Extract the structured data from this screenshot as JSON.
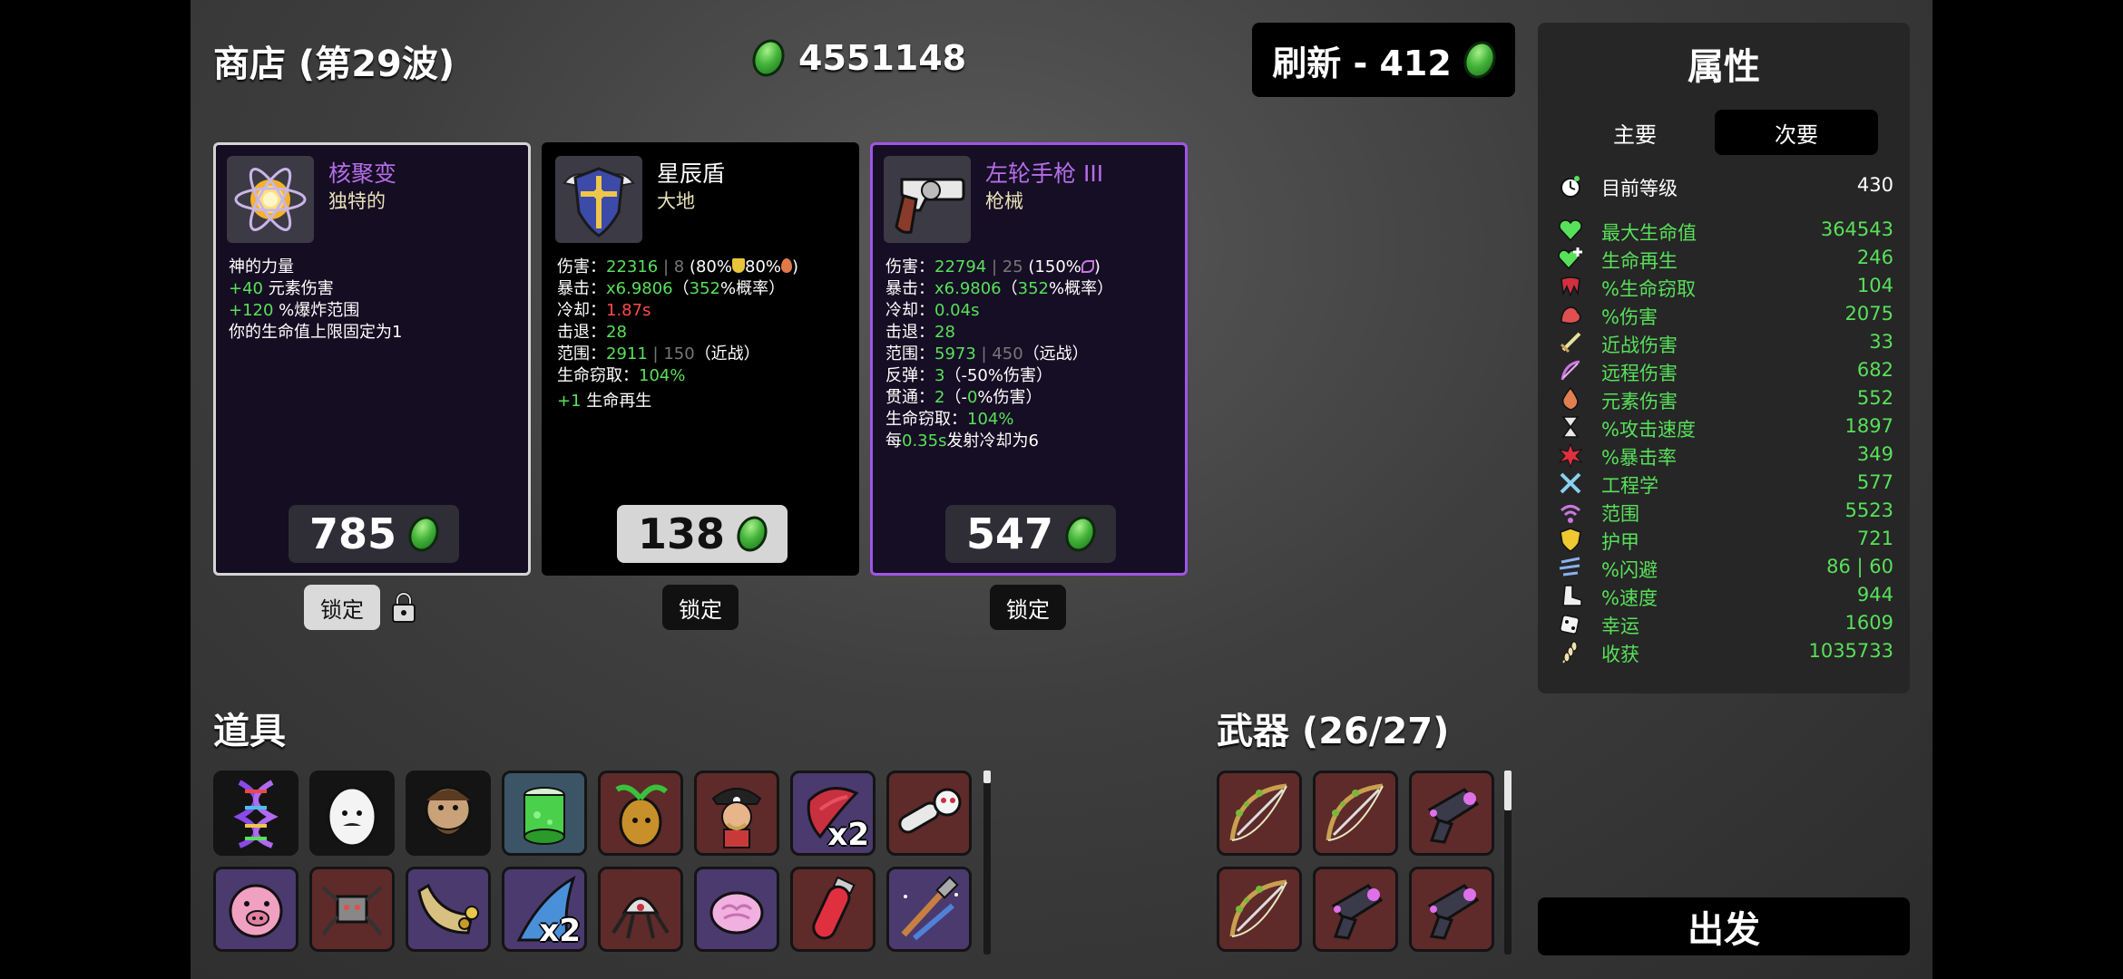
{
  "header": {
    "shop_title": "商店 (第29波)",
    "materials": "4551148",
    "reroll_label": "刷新 - 412"
  },
  "shop": {
    "items": [
      {
        "name": "核聚变",
        "name_color": "#b46ee8",
        "type": "独特的",
        "icon": "nuclear-atom-icon",
        "desc": {
          "l1": "神的力量",
          "l2_val": "+40",
          "l2_txt": " 元素伤害",
          "l3_val": "+120",
          "l3_txt": " %爆炸范围",
          "l4": "你的生命值上限固定为1"
        },
        "price": "785",
        "lock_label": "锁定",
        "locked": true
      },
      {
        "name": "星辰盾",
        "name_color": "#ffffff",
        "type": "大地",
        "icon": "star-shield-icon",
        "stats": {
          "dmg_k": "伤害：",
          "dmg_v": "22316",
          "dmg_sep": " | ",
          "dmg_base": "8",
          "dmg_tail": " (80%",
          "dmg_tail2": "80%",
          "dmg_close": ")",
          "crit_k": "暴击：",
          "crit_v": "x6.9806",
          "crit_tail": "（",
          "crit_pct": "352",
          "crit_tail2": "%概率）",
          "cd_k": "冷却：",
          "cd_v": "1.87s",
          "kb_k": "击退：",
          "kb_v": "28",
          "range_k": "范围：",
          "range_v": "2911",
          "range_sep": " | ",
          "range_base": "150",
          "range_tail": "（近战）",
          "ls_k": "生命窃取：",
          "ls_v": "104%",
          "extra_v": "+1",
          "extra_txt": " 生命再生"
        },
        "price": "138",
        "lock_label": "锁定"
      },
      {
        "name": "左轮手枪 III",
        "name_color": "#b46ee8",
        "type": "枪械",
        "icon": "revolver-icon",
        "stats": {
          "dmg_k": "伤害：",
          "dmg_v": "22794",
          "dmg_sep": " | ",
          "dmg_base": "25",
          "dmg_tail": " (150%",
          "dmg_close": ")",
          "crit_k": "暴击：",
          "crit_v": "x6.9806",
          "crit_tail": "（",
          "crit_pct": "352",
          "crit_tail2": "%概率）",
          "cd_k": "冷却：",
          "cd_v": "0.04s",
          "kb_k": "击退：",
          "kb_v": "28",
          "range_k": "范围：",
          "range_v": "5973",
          "range_sep": " | ",
          "range_base": "450",
          "range_tail": "（远战）",
          "bounce_k": "反弹：",
          "bounce_v": "3",
          "bounce_tail": "（-50%伤害）",
          "pierce_k": "贯通：",
          "pierce_v": "2",
          "pierce_tail1": "（-",
          "pierce_tail_v": "0",
          "pierce_tail2": "%伤害）",
          "ls_k": "生命窃取：",
          "ls_v": "104%",
          "reload_pre": "每",
          "reload_v": "0.35s",
          "reload_post": "发射冷却为6"
        },
        "price": "547",
        "lock_label": "锁定"
      }
    ]
  },
  "items_section": {
    "title": "道具",
    "slots": [
      {
        "icon": "dna-icon",
        "bg": "black"
      },
      {
        "icon": "egg-face-icon",
        "bg": "black"
      },
      {
        "icon": "bearded-face-icon",
        "bg": "black"
      },
      {
        "icon": "green-can-icon",
        "bg": "blue"
      },
      {
        "icon": "potato-sprout-icon",
        "bg": "red"
      },
      {
        "icon": "pirate-captain-icon",
        "bg": "red"
      },
      {
        "icon": "red-scarf-icon",
        "bg": "purple",
        "qty": "x2"
      },
      {
        "icon": "chainsaw-icon",
        "bg": "red"
      },
      {
        "icon": "pig-face-icon",
        "bg": "purple"
      },
      {
        "icon": "robot-spider-icon",
        "bg": "red"
      },
      {
        "icon": "cornucopia-icon",
        "bg": "purple"
      },
      {
        "icon": "shark-fin-icon",
        "bg": "purple",
        "qty": "x2"
      },
      {
        "icon": "helmet-spider-icon",
        "bg": "red"
      },
      {
        "icon": "pink-brain-icon",
        "bg": "purple"
      },
      {
        "icon": "red-vial-icon",
        "bg": "red"
      },
      {
        "icon": "tools-icon",
        "bg": "purple"
      }
    ]
  },
  "weapons_section": {
    "title": "武器 (26/27)",
    "slots": [
      {
        "icon": "bow-icon",
        "bg": "red"
      },
      {
        "icon": "bow-icon",
        "bg": "red"
      },
      {
        "icon": "blaster-icon",
        "bg": "red"
      },
      {
        "icon": "bow-icon",
        "bg": "red"
      },
      {
        "icon": "blaster-icon",
        "bg": "red"
      },
      {
        "icon": "blaster-icon",
        "bg": "red"
      }
    ]
  },
  "stats_panel": {
    "title": "属性",
    "tab_primary": "主要",
    "tab_secondary": "次要",
    "level_label": "目前等级",
    "level_value": "430",
    "stats": [
      {
        "label": "最大生命值",
        "value": "364543",
        "icon": "heart-icon",
        "color": "#58e05a"
      },
      {
        "label": "生命再生",
        "value": "246",
        "icon": "heart-plus-icon",
        "color": "#58e05a"
      },
      {
        "label": "%生命窃取",
        "value": "104",
        "icon": "fang-icon",
        "color": "#58e05a"
      },
      {
        "label": "%伤害",
        "value": "2075",
        "icon": "muscle-icon",
        "color": "#58e05a"
      },
      {
        "label": "近战伤害",
        "value": "33",
        "icon": "sword-icon",
        "color": "#58e05a"
      },
      {
        "label": "远程伤害",
        "value": "682",
        "icon": "bow-stat-icon",
        "color": "#58e05a"
      },
      {
        "label": "元素伤害",
        "value": "552",
        "icon": "flame-icon",
        "color": "#58e05a"
      },
      {
        "label": "%攻击速度",
        "value": "1897",
        "icon": "hourglass-icon",
        "color": "#58e05a"
      },
      {
        "label": "%暴击率",
        "value": "349",
        "icon": "crit-burst-icon",
        "color": "#58e05a"
      },
      {
        "label": "工程学",
        "value": "577",
        "icon": "wrench-cross-icon",
        "color": "#58e05a"
      },
      {
        "label": "范围",
        "value": "5523",
        "icon": "range-wave-icon",
        "color": "#58e05a"
      },
      {
        "label": "护甲",
        "value": "721",
        "icon": "shield-icon",
        "color": "#58e05a"
      },
      {
        "label": "%闪避",
        "value": "86 | 60",
        "icon": "dodge-icon",
        "color": "#58e05a"
      },
      {
        "label": "%速度",
        "value": "944",
        "icon": "boot-icon",
        "color": "#58e05a"
      },
      {
        "label": "幸运",
        "value": "1609",
        "icon": "dice-icon",
        "color": "#58e05a"
      },
      {
        "label": "收获",
        "value": "1035733",
        "icon": "wheat-icon",
        "color": "#58e05a"
      }
    ]
  },
  "go_button": "出发"
}
